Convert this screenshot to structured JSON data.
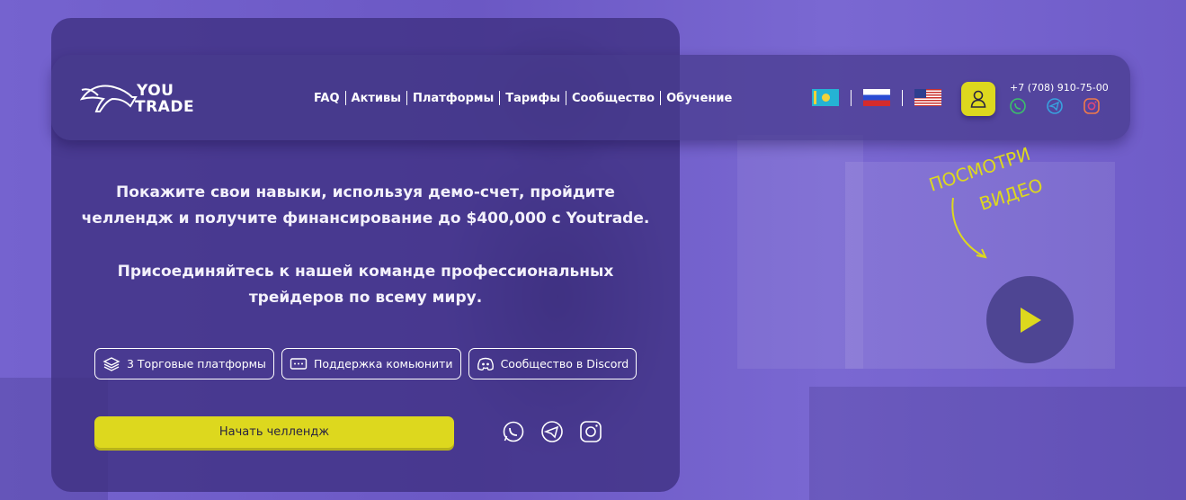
{
  "brand": {
    "logo_line1": "YOU",
    "logo_line2": "TRADE"
  },
  "nav": {
    "items": [
      "FAQ",
      "Активы",
      "Платформы",
      "Тарифы",
      "Сообщество",
      "Обучение"
    ]
  },
  "languages": [
    "kz-flag-icon",
    "ru-flag-icon",
    "us-flag-icon"
  ],
  "contact": {
    "phone": "+7 (708) 910-75-00",
    "social": [
      "whatsapp-icon",
      "telegram-icon",
      "instagram-icon"
    ]
  },
  "hero": {
    "headline_line1": "Покажите свои навыки, используя демо-счет, пройдите",
    "headline_line2": "челлендж и получите финансирование до $400,000 с Youtrade.",
    "sub_line1": "Присоединяйтесь к нашей команде профессиональных",
    "sub_line2": "трейдеров по всему миру.",
    "features": [
      "3 Торговые платформы",
      "Поддержка комьюнити",
      "Сообщество в Discord"
    ],
    "cta_label": "Начать челлендж"
  },
  "video": {
    "prompt_line1": "ПОСМОТРИ",
    "prompt_line2": "ВИДЕО"
  },
  "colors": {
    "accent": "#ddd81e",
    "background": "#6e5bc4",
    "panel": "#3e3080",
    "play": "#4e4593"
  }
}
